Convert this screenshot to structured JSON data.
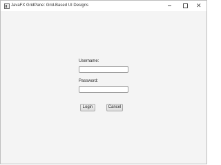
{
  "window": {
    "title": "JavaFX GridPane: Grid-Based UI Designs",
    "icons": {
      "app": "app-icon",
      "minimize": "minimize-icon",
      "maximize": "maximize-icon",
      "close": "close-icon"
    },
    "close_glyph": "✕"
  },
  "form": {
    "username_label": "Username:",
    "username_value": "",
    "password_label": "Password:",
    "password_value": "",
    "login_label": "Login",
    "cancel_label": "Cancel"
  }
}
